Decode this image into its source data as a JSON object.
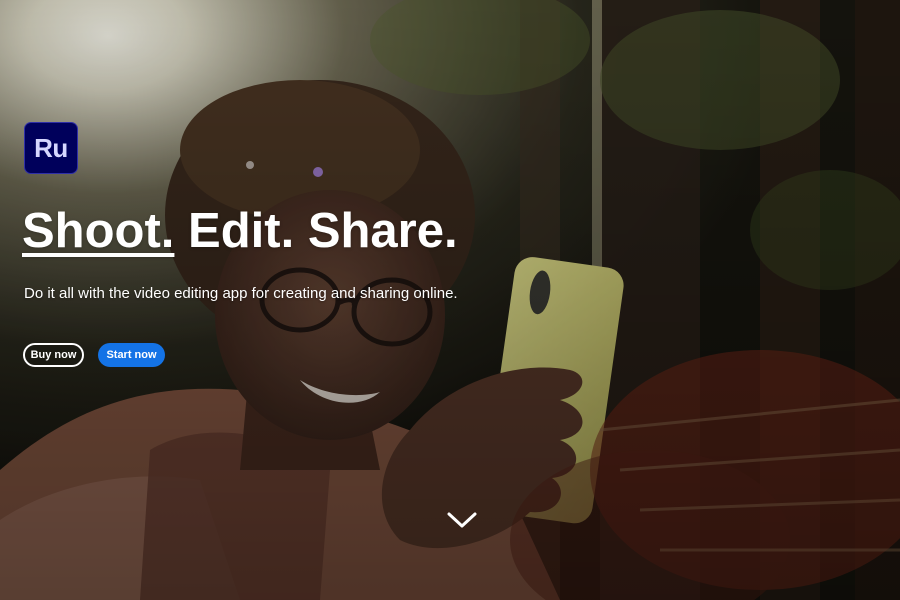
{
  "hero": {
    "app_badge": "Ru",
    "headline": {
      "part1": "Shoot.",
      "part2": "Edit. Share."
    },
    "subhead": "Do it all with the video editing app for creating and sharing online.",
    "buy_button_label": "Buy now",
    "start_button_label": "Start now",
    "scroll_icon": "chevron-down-icon"
  },
  "colors": {
    "badge_bg": "#00005b",
    "badge_text": "#d6d7ff",
    "primary_button": "#1473e6",
    "text": "#ffffff"
  }
}
